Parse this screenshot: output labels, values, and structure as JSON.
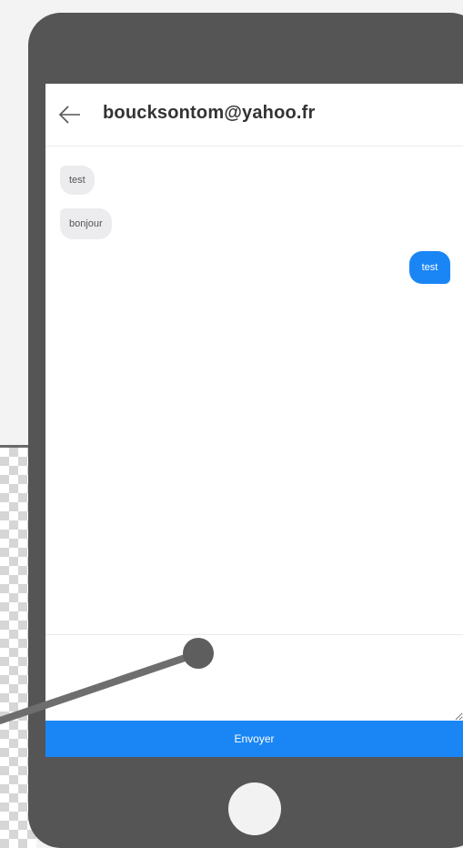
{
  "header": {
    "title": "boucksontom@yahoo.fr",
    "back_icon": "arrow-left-icon"
  },
  "messages": [
    {
      "direction": "incoming",
      "text": "test"
    },
    {
      "direction": "incoming",
      "text": "bonjour"
    },
    {
      "direction": "outgoing",
      "text": "test"
    }
  ],
  "composer": {
    "value": "",
    "placeholder": ""
  },
  "send_button": {
    "label": "Envoyer"
  },
  "colors": {
    "accent": "#1a86f5",
    "phone_frame": "#555555",
    "incoming_bubble": "#ececef"
  }
}
